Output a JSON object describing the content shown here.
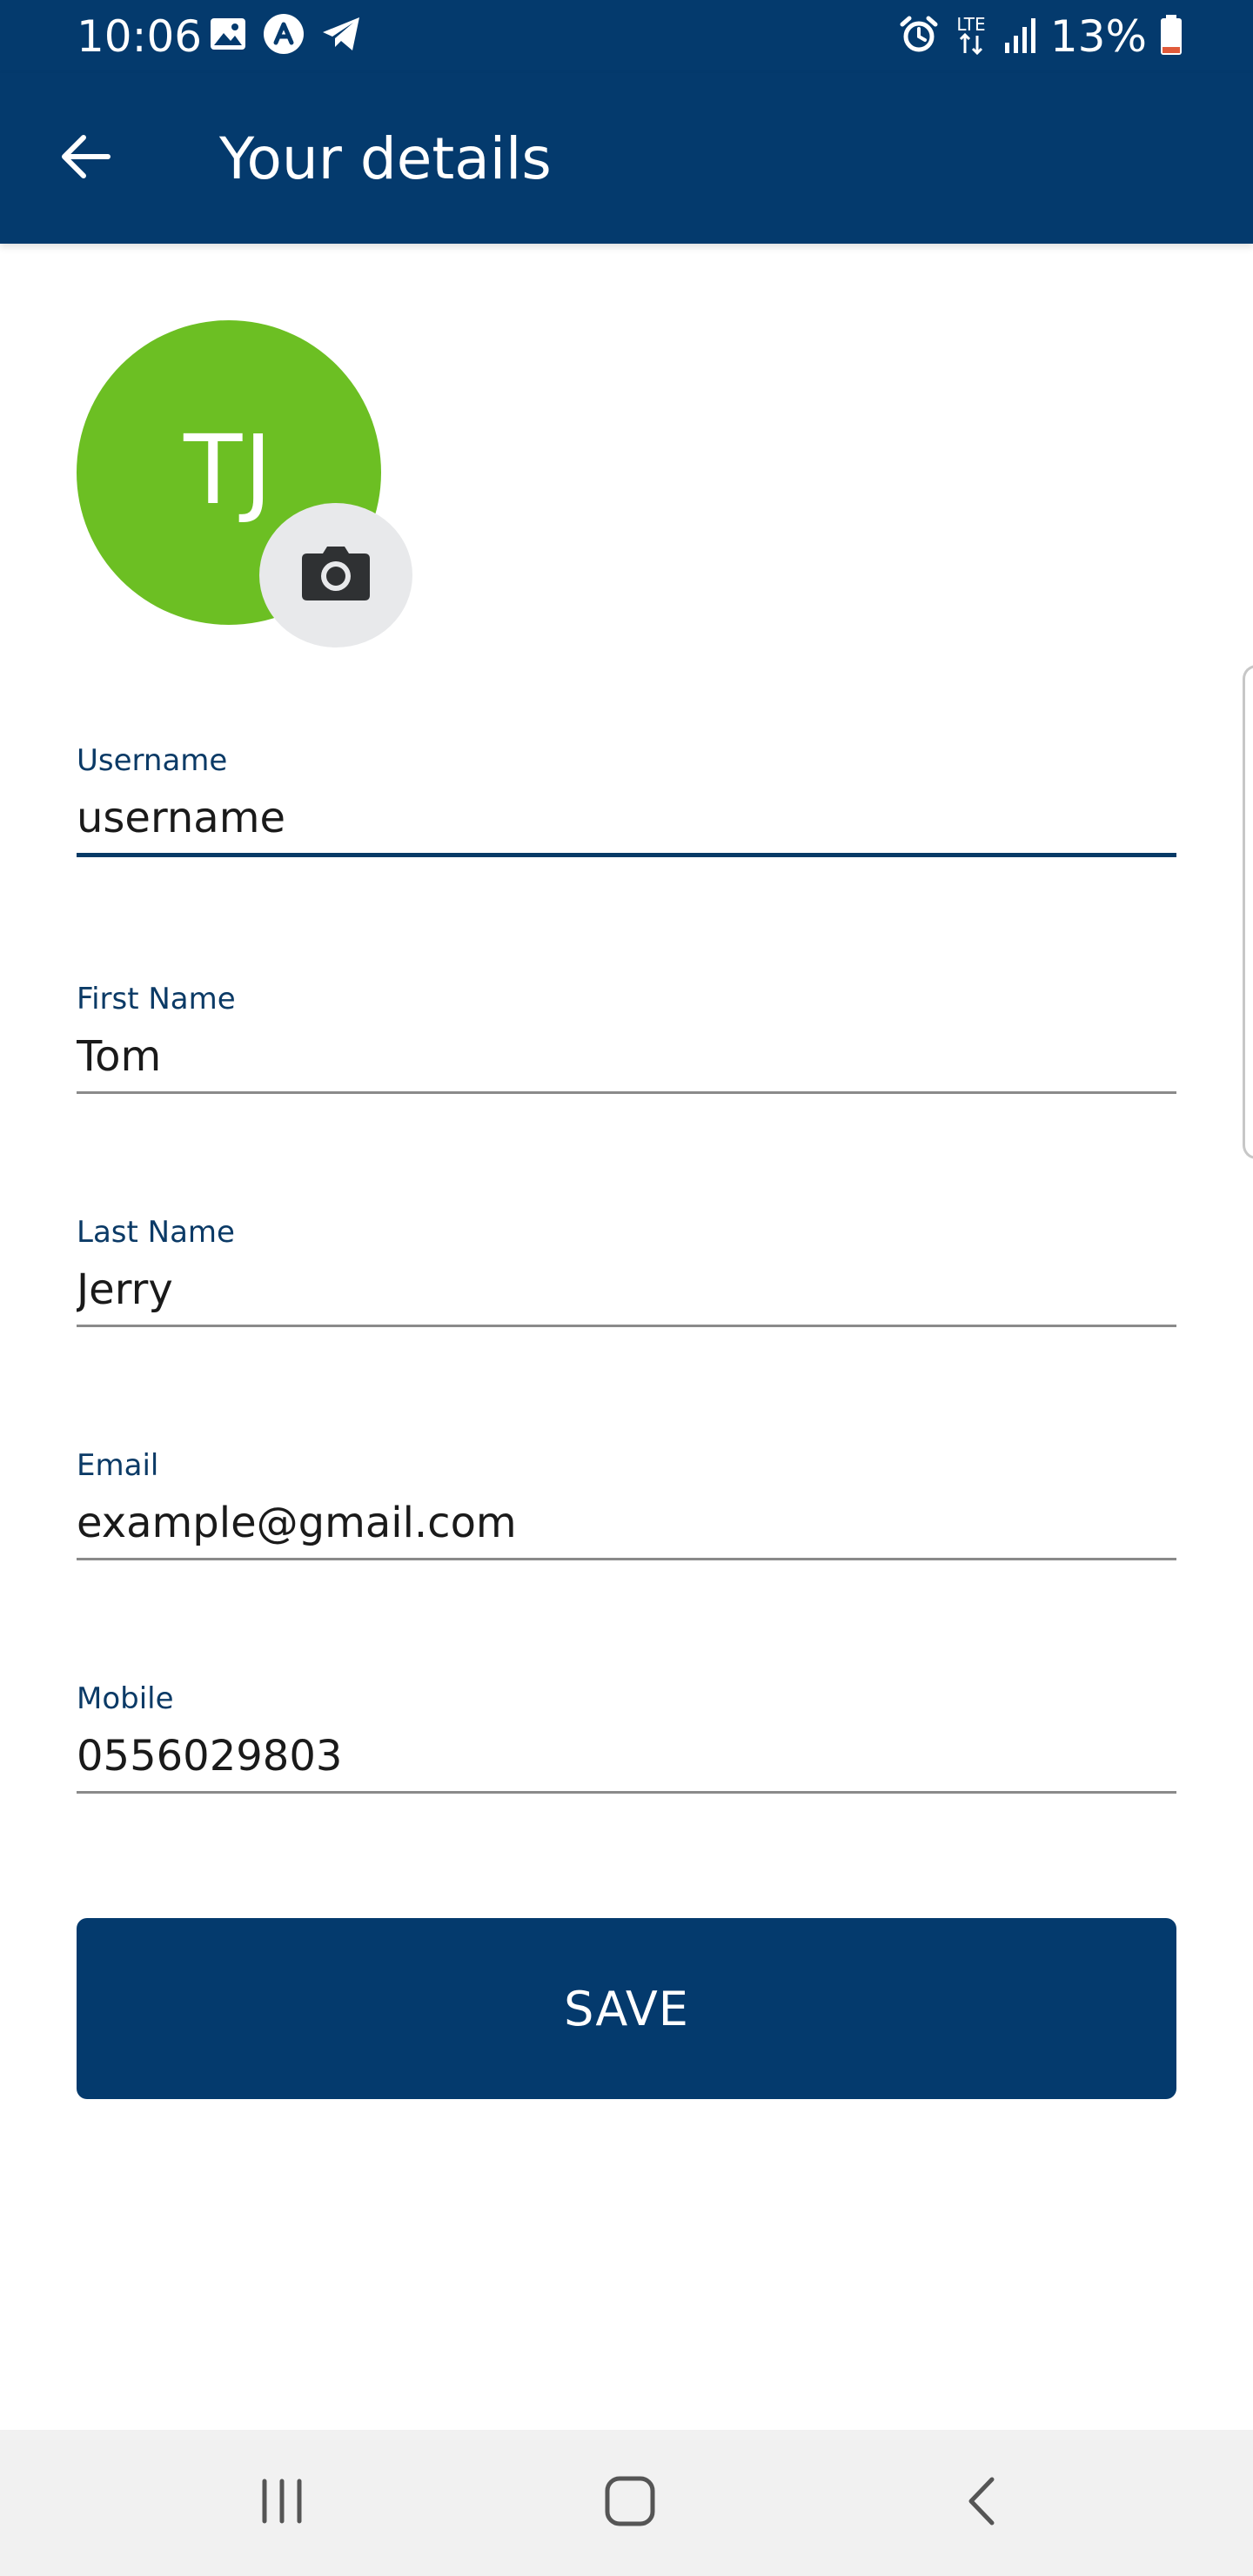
{
  "status_bar": {
    "time": "10:06",
    "battery_percent": "13%",
    "network_label": "LTE",
    "left_icons": [
      "gallery-icon",
      "app-notification-icon",
      "telegram-icon"
    ],
    "right_icons": [
      "alarm-icon",
      "lte-icon",
      "signal-icon",
      "battery-icon"
    ]
  },
  "app_bar": {
    "title": "Your details",
    "back_icon": "arrow-left-icon"
  },
  "profile": {
    "initials": "TJ",
    "avatar_color": "#6cbf23",
    "camera_icon": "camera-icon"
  },
  "form": {
    "fields": [
      {
        "label": "Username",
        "value": "username",
        "focused": true
      },
      {
        "label": "First Name",
        "value": "Tom",
        "focused": false
      },
      {
        "label": "Last Name",
        "value": "Jerry",
        "focused": false
      },
      {
        "label": "Email",
        "value": "example@gmail.com",
        "focused": false
      },
      {
        "label": "Mobile",
        "value": "0556029803",
        "focused": false
      }
    ],
    "save_label": "SAVE"
  },
  "nav_bar": {
    "icons": [
      "recent-apps-icon",
      "home-icon",
      "back-icon"
    ]
  },
  "colors": {
    "primary": "#043a6d",
    "avatar_green": "#6cbf23",
    "label_blue": "#0b3a66",
    "nav_background": "#f1f1f1",
    "battery_low": "#e05a3a"
  }
}
